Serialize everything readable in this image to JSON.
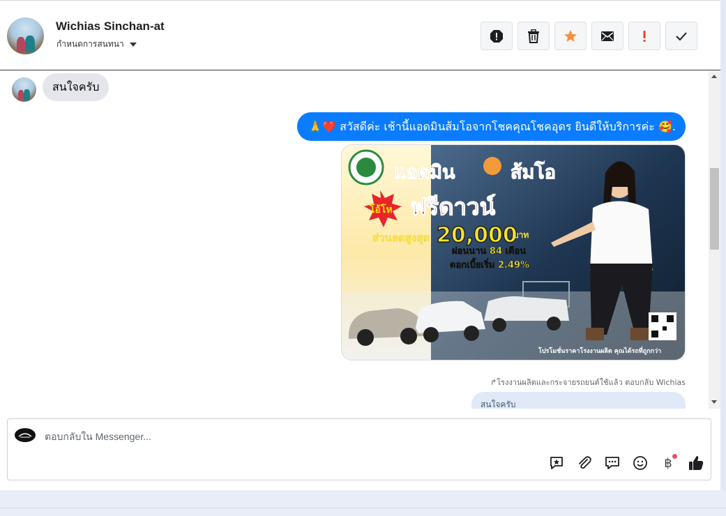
{
  "header": {
    "contact_name": "Wichias Sinchan-at",
    "subtitle": "กำหนดการสนทนา",
    "actions": [
      {
        "name": "spam-button",
        "icon": "report-icon"
      },
      {
        "name": "delete-button",
        "icon": "trash-icon"
      },
      {
        "name": "star-button",
        "icon": "star-icon",
        "color": "#f7923b"
      },
      {
        "name": "mark-unread-button",
        "icon": "envelope-icon"
      },
      {
        "name": "important-button",
        "icon": "exclamation-icon",
        "color": "#e0432c"
      },
      {
        "name": "mark-done-button",
        "icon": "check-icon"
      }
    ]
  },
  "messages": {
    "incoming_text": "สนใจครับ",
    "outgoing_emoji_prefix": "🙏❤️",
    "outgoing_text": "สวัสดีค่ะ เช้านี้แอดมินส้มโอจากโชคคุณโชคอุดร ยินดีให้บริการค่ะ",
    "outgoing_emoji_suffix": "🥰.",
    "promo": {
      "headline": "แอดมิน ส้มโอ",
      "badge": "โอ้โห",
      "offer": "ฟรีดาวน์",
      "discount_label": "ส่วนลดสูงสุด",
      "discount_value": "20,000",
      "discount_unit": "บาท",
      "installment": "ผ่อนนาน 84 เดือน",
      "interest": "ดอกเบี้ยเริ่ม 2.49%",
      "footer": "โปรโมชั่นราคาโรงงานผลิต คุณได้รถที่ถูกกว่า"
    },
    "reply_meta": "โรงงานผลิตและกระจายรถยนต์ใช้แล้ว ตอบกลับ Wichias",
    "reply_quote": "สนใจครับ"
  },
  "composer": {
    "placeholder": "ตอบกลับใน Messenger...",
    "tools": [
      {
        "name": "saved-reply-button",
        "icon": "saved-reply-icon"
      },
      {
        "name": "attach-button",
        "icon": "paperclip-icon"
      },
      {
        "name": "quick-reply-button",
        "icon": "chat-bubble-icon"
      },
      {
        "name": "emoji-button",
        "icon": "smiley-icon"
      },
      {
        "name": "payment-button",
        "icon": "baht-icon",
        "label": "฿"
      },
      {
        "name": "like-button",
        "icon": "thumbs-up-icon"
      }
    ]
  },
  "colors": {
    "outgoing_bubble": "#0a7cff",
    "incoming_bubble": "#e4e6eb",
    "notification_dot": "#e4516a"
  }
}
